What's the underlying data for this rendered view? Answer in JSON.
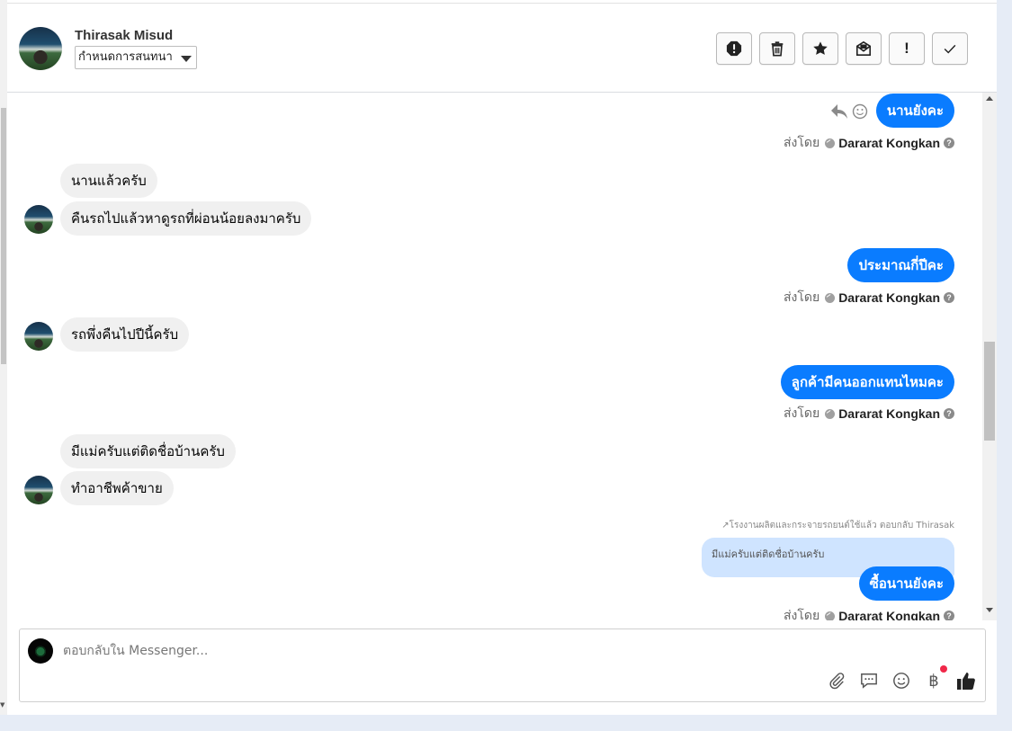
{
  "contact": {
    "name": "Thirasak Misud",
    "assign_label": "กำหนดการสนทนา"
  },
  "toolbar": [
    "alert-icon",
    "trash-icon",
    "star-icon",
    "mark-unread-icon",
    "important-icon",
    "check-icon"
  ],
  "messages": [
    {
      "dir": "out",
      "text": "นานยังคะ"
    },
    {
      "dir": "in",
      "text": "นานแล้วครับ"
    },
    {
      "dir": "in",
      "text": "คืนรถไปแล้วหาดูรถที่ผ่อนน้อยลงมาครับ"
    },
    {
      "dir": "out",
      "text": "ประมาณกี่ปีคะ"
    },
    {
      "dir": "in",
      "text": "รถพึ่งคืนไปปีนี้ครับ"
    },
    {
      "dir": "out",
      "text": "ลูกค้ามีคนออกแทนไหมคะ"
    },
    {
      "dir": "in",
      "text": "มีแม่ครับแต่ติดชื่อบ้านครับ"
    },
    {
      "dir": "in",
      "text": "ทำอาชีพค้าขาย"
    },
    {
      "dir": "out",
      "text": "ซื้อนานยังคะ"
    }
  ],
  "sender": {
    "by_label": "ส่งโดย",
    "name": "Dararat Kongkan"
  },
  "reply": {
    "note": "โรงงานผลิตและกระจายรถยนต์ใช้แล้ว ตอบกลับ Thirasak",
    "quoted": "มีแม่ครับแต่ติดชื่อบ้านครับ"
  },
  "composer": {
    "placeholder": "ตอบกลับใน Messenger..."
  },
  "colors": {
    "accent": "#0a7cff",
    "incoming": "#f0f0f0",
    "quoted": "#cfe4ff",
    "badge": "#f02849"
  }
}
